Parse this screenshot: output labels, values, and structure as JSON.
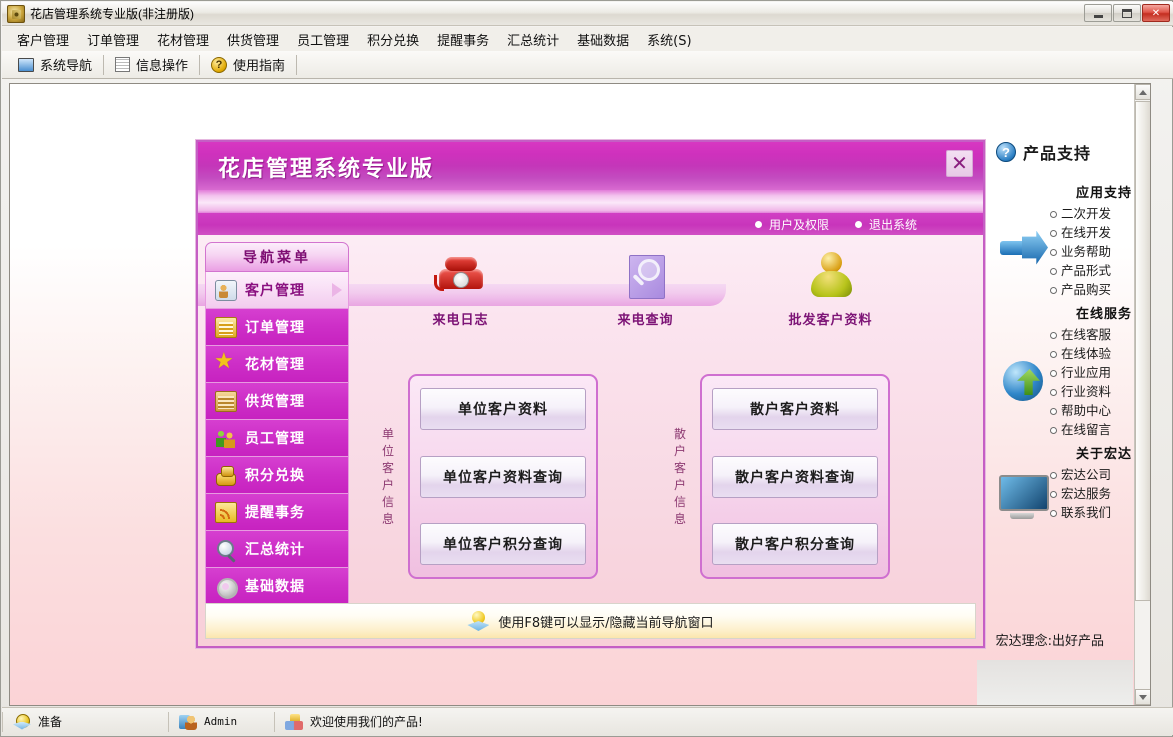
{
  "window": {
    "title": "花店管理系统专业版(非注册版)",
    "icon": "flower-app-icon",
    "buttons": {
      "minimize": "minimize-button",
      "maximize": "maximize-button",
      "close": "close-button"
    }
  },
  "menubar": {
    "items": [
      {
        "label": "客户管理"
      },
      {
        "label": "订单管理"
      },
      {
        "label": "花材管理"
      },
      {
        "label": "供货管理"
      },
      {
        "label": "员工管理"
      },
      {
        "label": "积分兑换"
      },
      {
        "label": "提醒事务"
      },
      {
        "label": "汇总统计"
      },
      {
        "label": "基础数据"
      },
      {
        "label": "系统(S)"
      }
    ]
  },
  "toolbar": {
    "items": [
      {
        "label": "系统导航",
        "icon": "monitor-icon"
      },
      {
        "label": "信息操作",
        "icon": "grid-icon"
      },
      {
        "label": "使用指南",
        "icon": "question-mark-icon"
      }
    ]
  },
  "nav_window": {
    "title": "花店管理系统专业版",
    "close_label": "✕",
    "links": [
      {
        "label": "用户及权限"
      },
      {
        "label": "退出系统"
      }
    ],
    "side_menu": {
      "caption": "导航菜单",
      "items": [
        {
          "label": "客户管理",
          "icon": "contact-card-icon",
          "active": true
        },
        {
          "label": "订单管理",
          "icon": "order-book-icon",
          "active": false
        },
        {
          "label": "花材管理",
          "icon": "star-icon",
          "active": false
        },
        {
          "label": "供货管理",
          "icon": "boxes-icon",
          "active": false
        },
        {
          "label": "员工管理",
          "icon": "users-icon",
          "active": false
        },
        {
          "label": "积分兑换",
          "icon": "coins-icon",
          "active": false
        },
        {
          "label": "提醒事务",
          "icon": "rss-icon",
          "active": false
        },
        {
          "label": "汇总统计",
          "icon": "magnifier-icon",
          "active": false
        },
        {
          "label": "基础数据",
          "icon": "gear-icon",
          "active": false
        }
      ]
    },
    "shortcuts": [
      {
        "label": "来电日志",
        "icon": "telephone-icon"
      },
      {
        "label": "来电查询",
        "icon": "book-search-icon"
      },
      {
        "label": "批发客户资料",
        "icon": "person-icon"
      }
    ],
    "groups": [
      {
        "vertical_label": "单位客户信息",
        "buttons": [
          {
            "label": "单位客户资料"
          },
          {
            "label": "单位客户资料查询"
          },
          {
            "label": "单位客户积分查询"
          }
        ]
      },
      {
        "vertical_label": "散户客户信息",
        "buttons": [
          {
            "label": "散户客户资料"
          },
          {
            "label": "散户客户资料查询"
          },
          {
            "label": "散户客户积分查询"
          }
        ]
      }
    ],
    "tip": {
      "icon": "lightbulb-icon",
      "text": "使用F8键可以显示/隐藏当前导航窗口"
    }
  },
  "support_panel": {
    "title": "产品支持",
    "title_icon": "question-circle-icon",
    "sections": [
      {
        "heading": "应用支持",
        "icon": "blue-arrow-icon",
        "links": [
          "二次开发",
          "在线开发",
          "业务帮助",
          "产品形式",
          "产品购买"
        ]
      },
      {
        "heading": "在线服务",
        "icon": "globe-icon",
        "links": [
          "在线客服",
          "在线体验",
          "行业应用",
          "行业资料",
          "帮助中心",
          "在线留言"
        ]
      },
      {
        "heading": "关于宏达",
        "icon": "monitor-icon",
        "links": [
          "宏达公司",
          "宏达服务",
          "联系我们"
        ]
      }
    ]
  },
  "motto": "宏达理念:出好产品",
  "statusbar": {
    "cells": [
      {
        "icon": "ready-icon",
        "text": "准备"
      },
      {
        "icon": "user-icon",
        "text": "Admin"
      },
      {
        "icon": "cubes-icon",
        "text": "欢迎使用我们的产品!"
      }
    ]
  },
  "colors": {
    "brand_magenta": "#c734bf",
    "header_gradient_start": "#d738c2",
    "panel_border": "#cf6fd0",
    "client_bg_bottom": "#fbd3d6",
    "title_text": "#7d0d72"
  }
}
